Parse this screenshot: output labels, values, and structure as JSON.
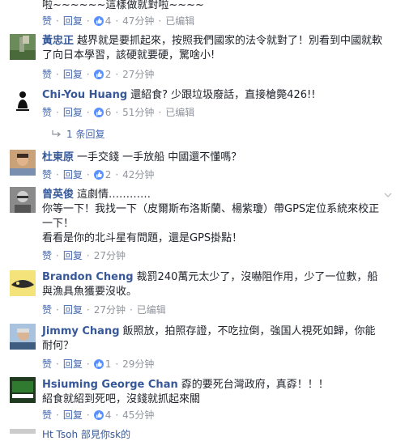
{
  "top_comment": {
    "text_tail": "啦~~~~~~這樣做就對啦~~~~",
    "like": "赞",
    "reply": "回复",
    "likes": "4",
    "time": "47分钟",
    "edited": "已编辑"
  },
  "comments": [
    {
      "author": "黃忠正",
      "text": "越界就是要抓起來，按照我們國家的法令就對了！別看到中國就軟了向日本學習，該硬就要硬，驚啥小!",
      "like": "赞",
      "reply": "回复",
      "likes": "2",
      "time": "27分钟"
    },
    {
      "author": "Chi-You Huang",
      "text": "還紹食? 少跟垃圾廢話，直接槍斃426!!",
      "like": "赞",
      "reply": "回复",
      "likes": "6",
      "time": "51分钟",
      "edited": "已编辑",
      "replies_label": "1 条回复"
    },
    {
      "author": "杜東原",
      "text": "一手交錢 一手放船 中國還不懂嗎？",
      "like": "赞",
      "reply": "回复",
      "likes": "2",
      "time": "42分钟"
    },
    {
      "author": "曾英俊",
      "text": "這劇情…………\n你等一下！我找一下（皮爾斯布洛斯蘭、楊紫瓊）帶GPS定位系統來校正一下！\n看看是你的北斗星有問題，還是GPS掛點！",
      "like": "赞",
      "reply": "回复",
      "time": "27分钟"
    },
    {
      "author": "Brandon Cheng",
      "text": "裁罰240萬元太少了，沒嚇阻作用，少了一位數，船與漁具魚獲要沒收。",
      "like": "赞",
      "reply": "回复",
      "time": "27分钟",
      "edited": "已编辑"
    },
    {
      "author": "Jimmy Chang",
      "text": "飯照放，拍照存證，不吃拉倒，強国人視死如歸，你能耐何？",
      "like": "赞",
      "reply": "回复",
      "likes": "1",
      "time": "29分钟"
    },
    {
      "author": "Hsiuming George Chan",
      "text": "孬的要死台灣政府，真孬！！！\n紹食就紹到死吧，沒錢就抓起來關",
      "like": "赞",
      "reply": "回复",
      "likes": "4",
      "time": "45分钟"
    }
  ],
  "next_partial": "Ht Tsoh  部見你sk的"
}
